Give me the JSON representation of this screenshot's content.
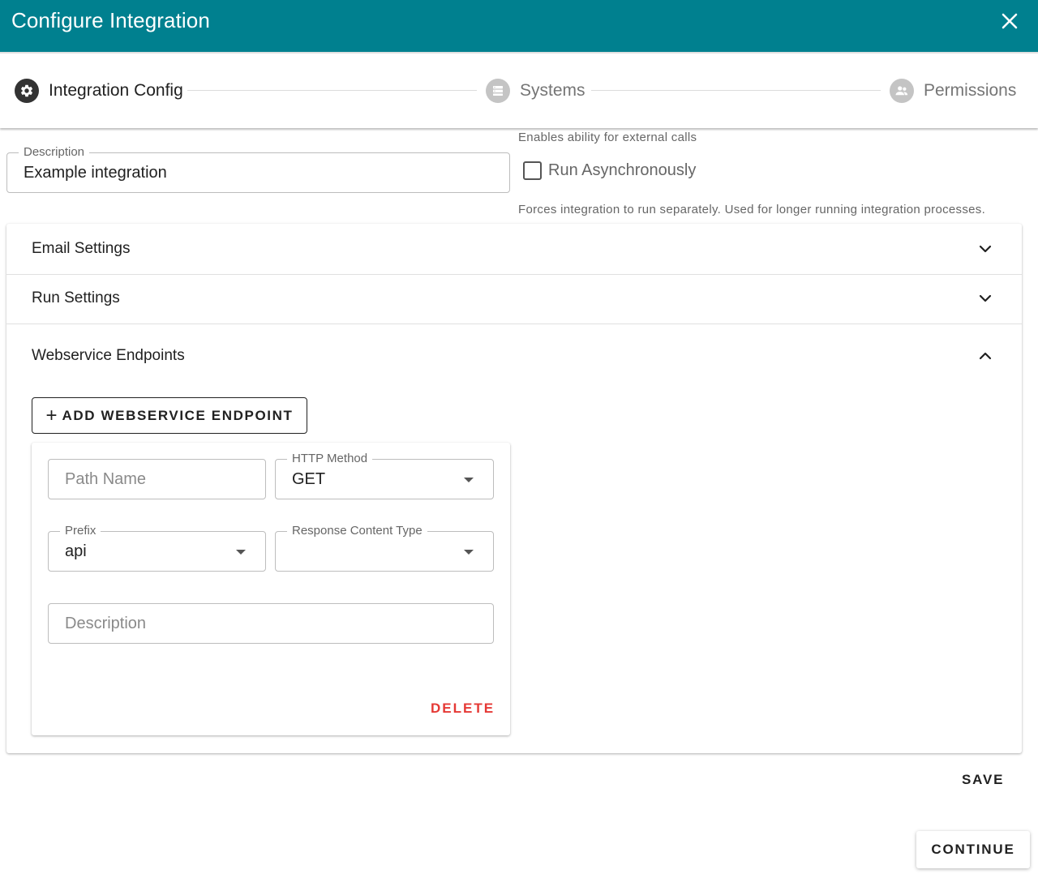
{
  "dialog": {
    "title": "Configure Integration",
    "close_icon": "close-icon"
  },
  "stepper": {
    "steps": [
      {
        "label": "Integration Config",
        "icon": "gear-icon",
        "state": "active"
      },
      {
        "label": "Systems",
        "icon": "server-icon",
        "state": "inactive"
      },
      {
        "label": "Permissions",
        "icon": "people-icon",
        "state": "inactive"
      }
    ]
  },
  "general": {
    "description_label": "Description",
    "description_value": "Example integration",
    "external_calls_helper": "Enables ability for external calls",
    "run_async_label": "Run Asynchronously",
    "run_async_checked": false,
    "run_async_helper": "Forces integration to run separately. Used for longer running integration processes."
  },
  "sections": {
    "email_settings": "Email Settings",
    "run_settings": "Run Settings",
    "webservice_endpoints": "Webservice Endpoints"
  },
  "endpoints": {
    "add_button": "ADD WEBSERVICE ENDPOINT",
    "items": [
      {
        "path_name_placeholder": "Path Name",
        "http_method_label": "HTTP Method",
        "http_method_value": "GET",
        "prefix_label": "Prefix",
        "prefix_value": "api",
        "response_content_type_label": "Response Content Type",
        "response_content_type_value": "",
        "description_placeholder": "Description",
        "delete_label": "DELETE"
      }
    ]
  },
  "footer": {
    "save_label": "SAVE",
    "continue_label": "CONTINUE"
  },
  "colors": {
    "header_bg": "#00808f",
    "step_active": "#333333",
    "step_inactive": "#c4c4c4",
    "delete": "#e53935"
  }
}
